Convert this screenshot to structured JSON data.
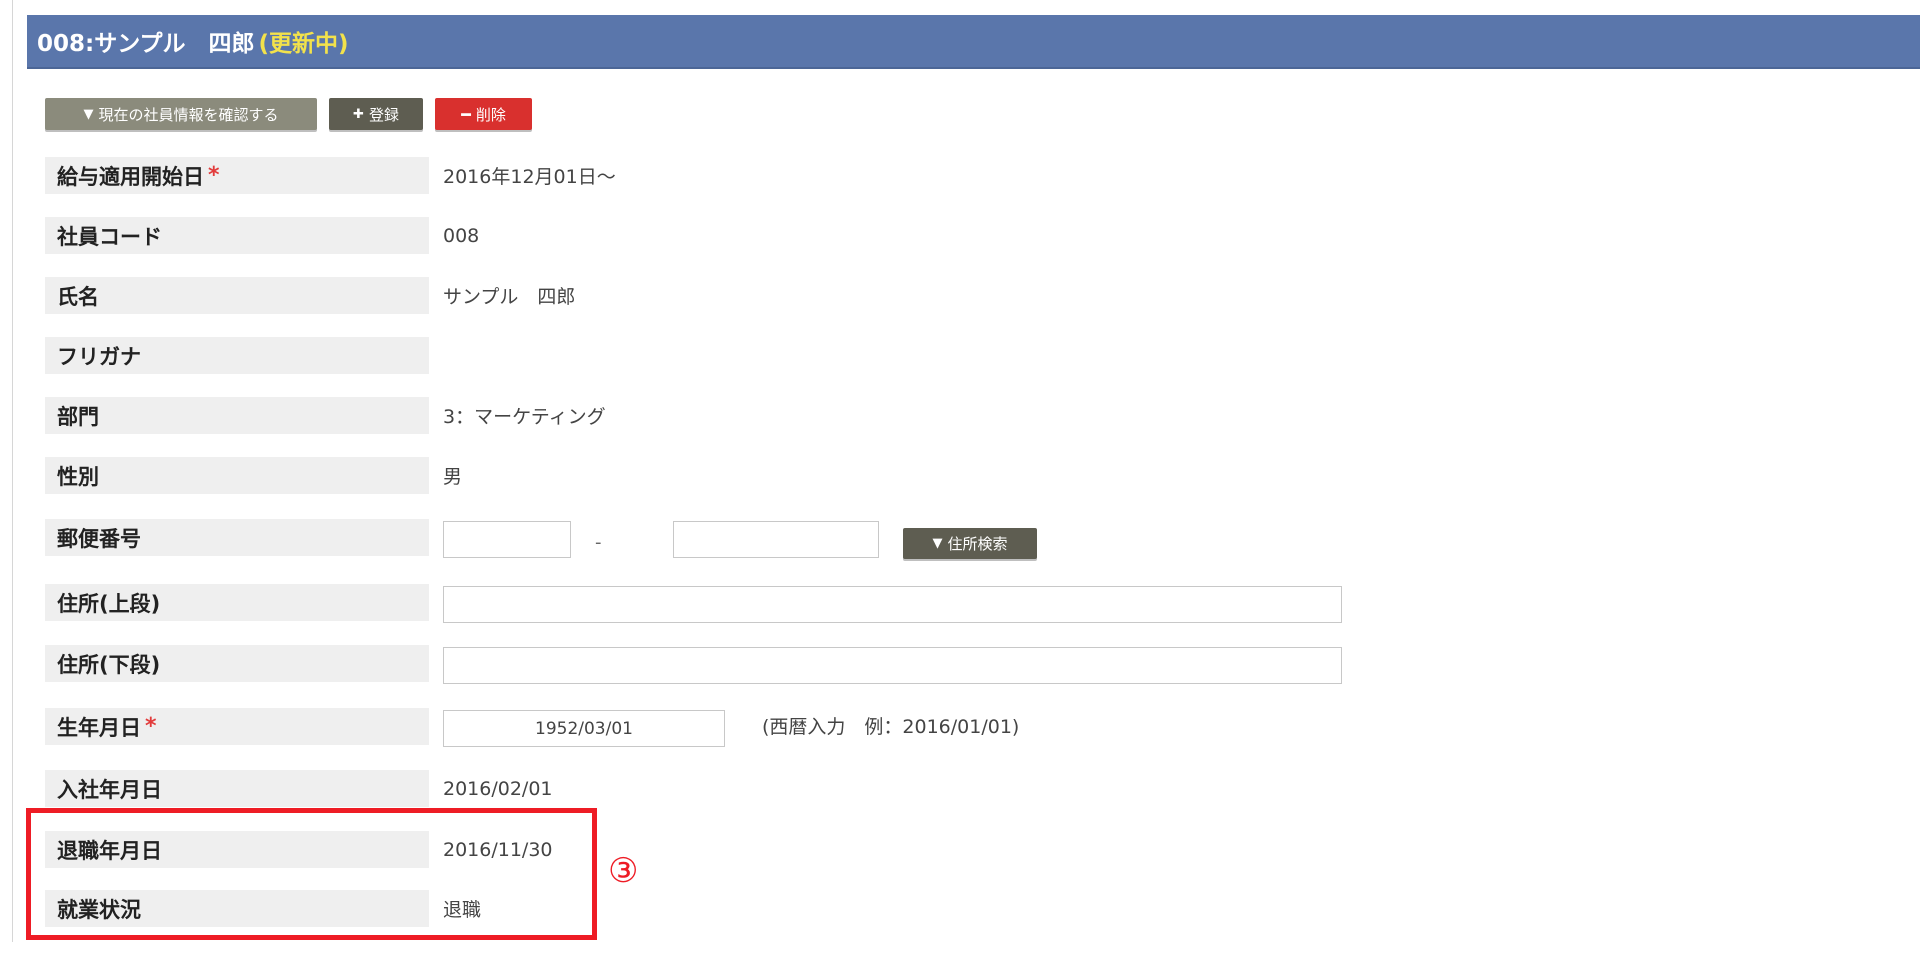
{
  "header": {
    "title": "008:サンプル　四郎",
    "status": "(更新中)"
  },
  "toolbar": {
    "confirm_label": "現在の社員情報を確認する",
    "register_label": "登録",
    "delete_label": "削除"
  },
  "form": {
    "rows": [
      {
        "label": "給与適用開始日",
        "required": "*",
        "value": "2016年12月01日〜"
      },
      {
        "label": "社員コード",
        "value": "008"
      },
      {
        "label": "氏名",
        "value": "サンプル　四郎"
      },
      {
        "label": "フリガナ",
        "value": ""
      },
      {
        "label": "部門",
        "value": "3：マーケティング"
      },
      {
        "label": "性別",
        "value": "男"
      },
      {
        "label": "郵便番号"
      },
      {
        "label": "住所(上段)"
      },
      {
        "label": "住所(下段)"
      },
      {
        "label": "生年月日",
        "required": "*"
      },
      {
        "label": "入社年月日",
        "value": "2016/02/01"
      },
      {
        "label": "退職年月日",
        "value": "2016/11/30"
      },
      {
        "label": "就業状況",
        "value": "退職"
      }
    ],
    "postal": {
      "part1": "",
      "part2": "",
      "separator": "-",
      "search_label": "住所検索"
    },
    "address_upper": "",
    "address_lower": "",
    "birthdate": "1952/03/01",
    "birthdate_hint": "(西暦入力　例：2016/01/01)"
  },
  "annotation": {
    "number": "③",
    "color": "#ee1c25"
  },
  "colors": {
    "title_bar": "#5a76ab",
    "status_text": "#f3e24b",
    "delete_button": "#d9302e",
    "dark_button": "#5e5d51",
    "grey_button": "#8b8b7c"
  }
}
